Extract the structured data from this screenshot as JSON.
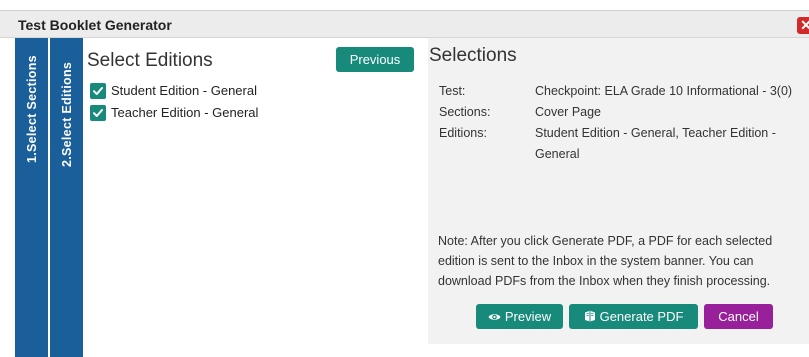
{
  "dialog": {
    "title": "Test Booklet Generator",
    "close_glyph": "✕"
  },
  "steps": [
    {
      "label": "1.Select Sections"
    },
    {
      "label": "2.Select Editions"
    }
  ],
  "editions_panel": {
    "heading": "Select Editions",
    "previous_label": "Previous",
    "editions": [
      {
        "label": "Student Edition - General",
        "checked": true
      },
      {
        "label": "Teacher Edition - General",
        "checked": true
      }
    ]
  },
  "selections_panel": {
    "heading": "Selections",
    "test_label": "Test:",
    "test_value": "Checkpoint: ELA Grade 10 Informational - 3(0)",
    "sections_label": "Sections:",
    "sections_value": "Cover Page",
    "editions_label": "Editions:",
    "editions_value": "Student Edition - General, Teacher Edition - General",
    "note": "Note: After you click Generate PDF, a PDF for each selected edition is sent to the Inbox in the system banner. You can download PDFs from the Inbox when they finish processing."
  },
  "actions": {
    "preview_label": "Preview",
    "preview_icon": "eye-icon",
    "generate_label": "Generate PDF",
    "generate_icon": "book-icon",
    "cancel_label": "Cancel"
  },
  "colors": {
    "step_tab": "#1a5e9a",
    "teal_button": "#178a7c",
    "cancel_button": "#98209a",
    "close_button": "#d02a2a",
    "panel_background": "#f2f2f2"
  }
}
